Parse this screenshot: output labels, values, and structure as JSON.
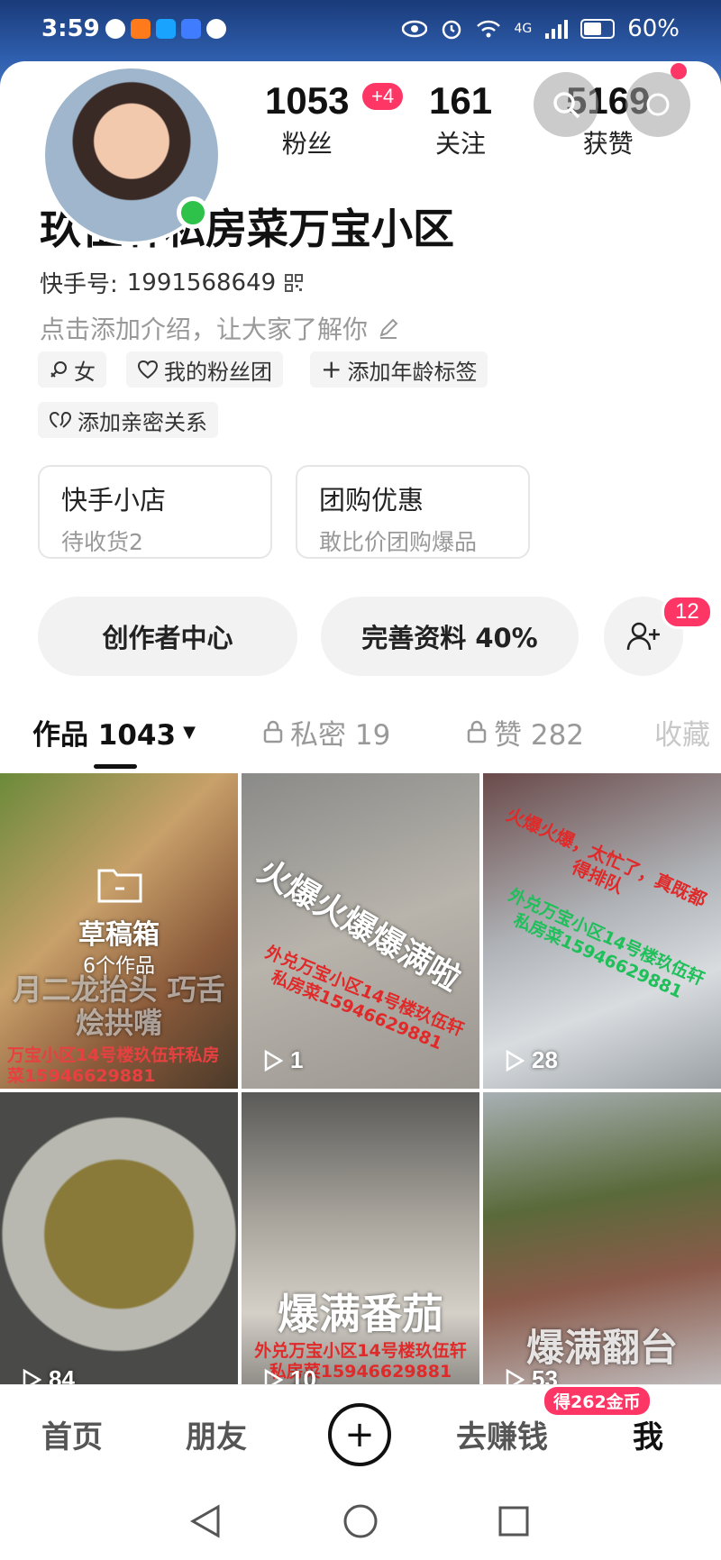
{
  "status_bar": {
    "time": "3:59",
    "network": "4G",
    "battery_text": "60%"
  },
  "profile": {
    "name": "玖伍轩私房菜万宝小区",
    "kuaishou_id_label": "快手号:",
    "kuaishou_id_value": "1991568649",
    "bio_placeholder": "点击添加介绍，让大家了解你",
    "online": true
  },
  "stats": {
    "followers": {
      "value": "1053",
      "label": "粉丝",
      "delta": "+4"
    },
    "following": {
      "value": "161",
      "label": "关注"
    },
    "likes": {
      "value": "5169",
      "label": "获赞"
    }
  },
  "chips": [
    {
      "label": "女",
      "icon": "female-icon"
    },
    {
      "label": "我的粉丝团",
      "icon": "heart-icon"
    },
    {
      "label": "添加年龄标签",
      "icon": "plus-icon"
    },
    {
      "label": "添加亲密关系",
      "icon": "link-hearts-icon"
    }
  ],
  "cards": [
    {
      "title": "快手小店",
      "sub": "待收货2"
    },
    {
      "title": "团购优惠",
      "sub": "敢比价团购爆品"
    }
  ],
  "pills": {
    "creator_center": "创作者中心",
    "complete_profile": "完善资料 40%",
    "add_friend_badge": "12"
  },
  "tabs": [
    {
      "label": "作品 1043",
      "active": true
    },
    {
      "label": "私密 19",
      "locked": true
    },
    {
      "label": "赞 282",
      "locked": true
    },
    {
      "label": "收藏"
    }
  ],
  "grid": [
    {
      "type": "drafts",
      "title": "草稿箱",
      "count": "6个作品",
      "overlay": "月二龙抬头 巧舌烩拱嘴",
      "footer": "万宝小区14号楼玖伍轩私房菜15946629881"
    },
    {
      "caption": "火爆火爆爆满啦",
      "red_text": "外兑万宝小区14号楼玖伍轩私房菜15946629881",
      "plays": "1"
    },
    {
      "caption": "火爆火爆，太忙了，真既都得排队",
      "red_text": "外兑万宝小区14号楼玖伍轩私房菜15946629881",
      "plays": "28"
    },
    {
      "caption": "",
      "plays": "84"
    },
    {
      "caption": "爆满番茄",
      "red_text": "外兑万宝小区14号楼玖伍轩私房菜15946629881",
      "plays": "10"
    },
    {
      "caption": "爆满翻台",
      "plays": "53"
    }
  ],
  "bottom_nav": {
    "home": "首页",
    "friends": "朋友",
    "earn": "去赚钱",
    "earn_badge": "得262金币",
    "me": "我"
  },
  "colors": {
    "accent_red": "#fe3666",
    "online_green": "#2fc24a"
  }
}
